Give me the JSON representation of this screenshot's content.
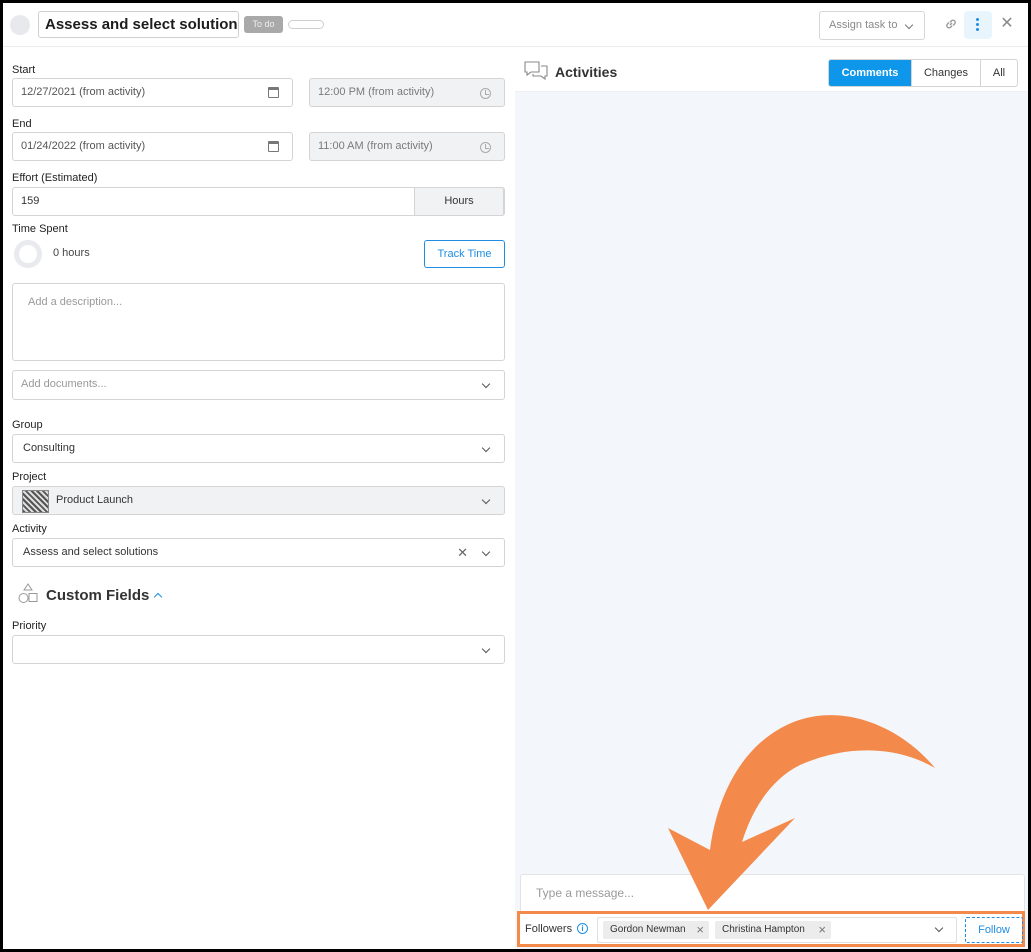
{
  "header": {
    "title": "Assess and select solutions",
    "status_badge": "To do",
    "assign_label": "Assign task to"
  },
  "schedule": {
    "start_label": "Start",
    "start_date": "12/27/2021 (from activity)",
    "start_time": "12:00 PM (from activity)",
    "end_label": "End",
    "end_date": "01/24/2022 (from activity)",
    "end_time": "11:00 AM (from activity)"
  },
  "effort": {
    "label": "Effort (Estimated)",
    "value": "159",
    "unit": "Hours"
  },
  "time_spent": {
    "label": "Time Spent",
    "value": "0 hours",
    "track_button": "Track Time"
  },
  "description": {
    "placeholder": "Add a description..."
  },
  "documents": {
    "placeholder": "Add documents..."
  },
  "group": {
    "label": "Group",
    "value": "Consulting"
  },
  "project": {
    "label": "Project",
    "value": "Product Launch"
  },
  "activity": {
    "label": "Activity",
    "value": "Assess and select solutions"
  },
  "custom_fields": {
    "title": "Custom Fields",
    "priority_label": "Priority",
    "priority_value": ""
  },
  "activities_panel": {
    "title": "Activities",
    "tabs": [
      {
        "label": "Comments",
        "active": true
      },
      {
        "label": "Changes",
        "active": false
      },
      {
        "label": "All",
        "active": false
      }
    ],
    "message_placeholder": "Type a message...",
    "followers_label": "Followers",
    "followers": [
      "Gordon Newman",
      "Christina Hampton"
    ],
    "follow_button": "Follow"
  },
  "colors": {
    "accent": "#1f8ee2",
    "active_tab": "#0e97ea",
    "highlight": "#f38a4b"
  }
}
